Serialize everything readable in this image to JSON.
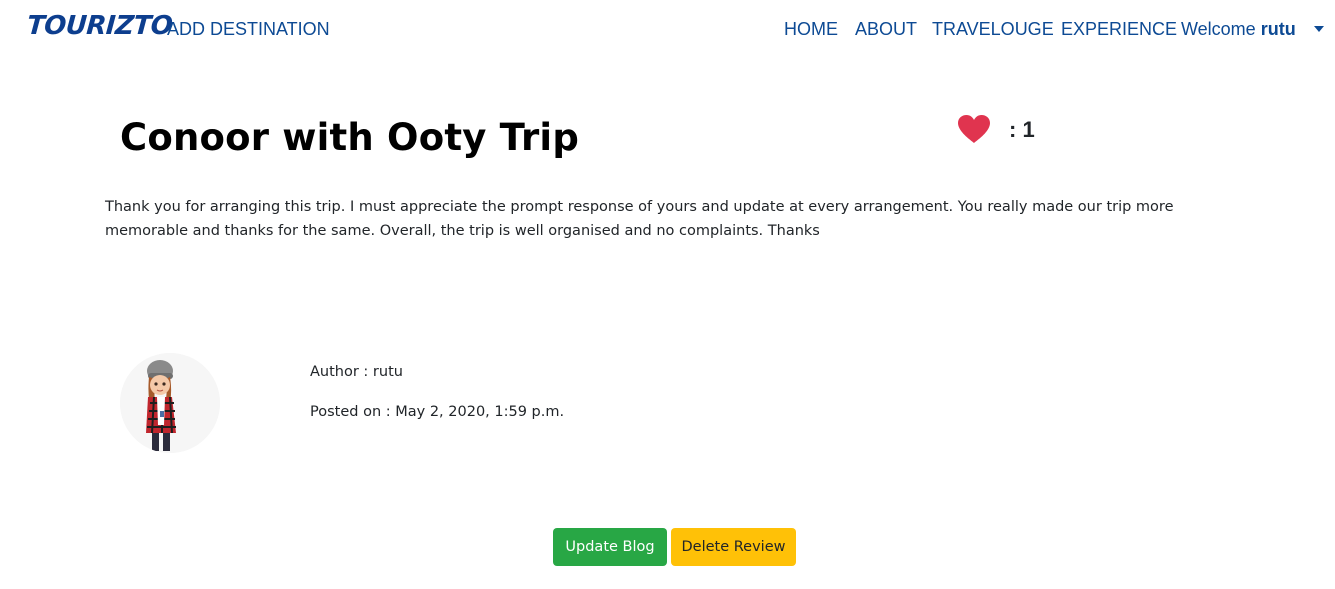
{
  "nav": {
    "brand": "TOURIZTO",
    "add_destination": "ADD DESTINATION",
    "home": "HOME",
    "about": "ABOUT",
    "travelouge": "TRAVELOUGE",
    "experience": "EXPERIENCE",
    "welcome_prefix": "Welcome ",
    "username": "rutu"
  },
  "post": {
    "title": "Conoor with Ooty Trip",
    "likes": ": 1",
    "body": "Thank you for arranging this trip. I must appreciate the prompt response of yours and update at every arrangement. You really made our trip more memorable and thanks for the same. Overall, the trip is well organised and no complaints. Thanks",
    "author": "Author : rutu",
    "posted_on": "Posted on : May 2, 2020, 1:59 p.m."
  },
  "actions": {
    "update": "Update Blog",
    "delete": "Delete Review"
  },
  "colors": {
    "brand": "#0d3e8e",
    "nav_link": "#0d4a94",
    "heart": "#e0344f",
    "update_button": "#28a745",
    "delete_button": "#ffc107"
  },
  "icons": {
    "like": "heart-icon",
    "dropdown": "caret-down-icon",
    "avatar": "avatar-image"
  }
}
